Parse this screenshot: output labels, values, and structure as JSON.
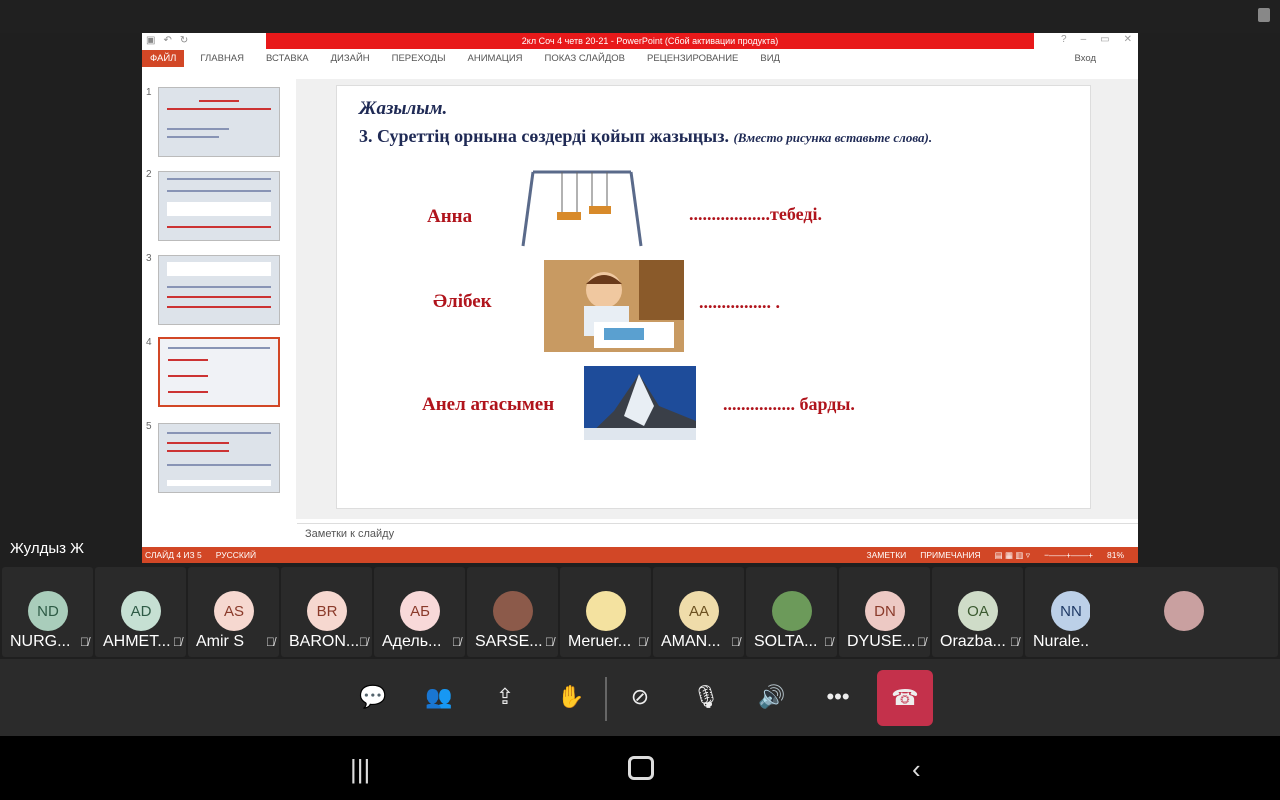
{
  "powerpoint": {
    "title": "2кл Соч 4 четв 20-21 - PowerPoint (Сбой активации продукта)",
    "ribbon_tabs": [
      "ФАЙЛ",
      "ГЛАВНАЯ",
      "ВСТАВКА",
      "ДИЗАЙН",
      "ПЕРЕХОДЫ",
      "АНИМАЦИЯ",
      "ПОКАЗ СЛАЙДОВ",
      "РЕЦЕНЗИРОВАНИЕ",
      "ВИД"
    ],
    "login": "Вход",
    "thumbnails": [
      "1",
      "2",
      "3",
      "4",
      "5"
    ],
    "active_slide": 4,
    "slide": {
      "heading": "Жазылым.",
      "task": "3. Суреттің орнына сөздерді қойып жазыңыз.",
      "task_ru": "(Вместо рисунка вставьте слова).",
      "rows": [
        {
          "left": "Анна",
          "right": "..................тебеді.",
          "image": "swing"
        },
        {
          "left": "Әлібек",
          "right": "................ .",
          "image": "boy-drawing"
        },
        {
          "left": "Анел атасымен",
          "right": "................ барды.",
          "image": "mountain"
        }
      ]
    },
    "notes_placeholder": "Заметки к слайду",
    "status": {
      "slide": "СЛАЙД 4 ИЗ 5",
      "language": "РУССКИЙ",
      "notes": "ЗАМЕТКИ",
      "comments": "ПРИМЕЧАНИЯ",
      "zoom": "81%"
    }
  },
  "presenter": "Жулдыз Ж",
  "participants": [
    {
      "initials": "ND",
      "name": "NURG...",
      "bg": "#a9cdbb",
      "fg": "#2e5b46"
    },
    {
      "initials": "AD",
      "name": "AHMET...",
      "bg": "#c6e0d3",
      "fg": "#2e5b46"
    },
    {
      "initials": "AS",
      "name": "Amir S",
      "bg": "#f6d8d0",
      "fg": "#8a3a2a"
    },
    {
      "initials": "BR",
      "name": "BARON...",
      "bg": "#f6d8d0",
      "fg": "#8a3a2a"
    },
    {
      "initials": "АБ",
      "name": "Адель...",
      "bg": "#f8d9d9",
      "fg": "#8a3a2a"
    },
    {
      "initials": "",
      "name": "SARSE...",
      "bg": "#8c5a4a",
      "fg": "#fff"
    },
    {
      "initials": "",
      "name": "Meruer...",
      "bg": "#f4e2a0",
      "fg": "#fff"
    },
    {
      "initials": "AA",
      "name": "AMAN...",
      "bg": "#efdcaa",
      "fg": "#6b5020"
    },
    {
      "initials": "",
      "name": "SOLTA...",
      "bg": "#6c9a5a",
      "fg": "#fff"
    },
    {
      "initials": "DN",
      "name": "DYUSE...",
      "bg": "#edc9c4",
      "fg": "#8a3a2a"
    },
    {
      "initials": "OA",
      "name": "Orazba...",
      "bg": "#cfdcc8",
      "fg": "#3b5a30"
    },
    {
      "initials": "NN",
      "name": "Nurale..",
      "bg": "#bcd0e8",
      "fg": "#1f3a66"
    }
  ]
}
